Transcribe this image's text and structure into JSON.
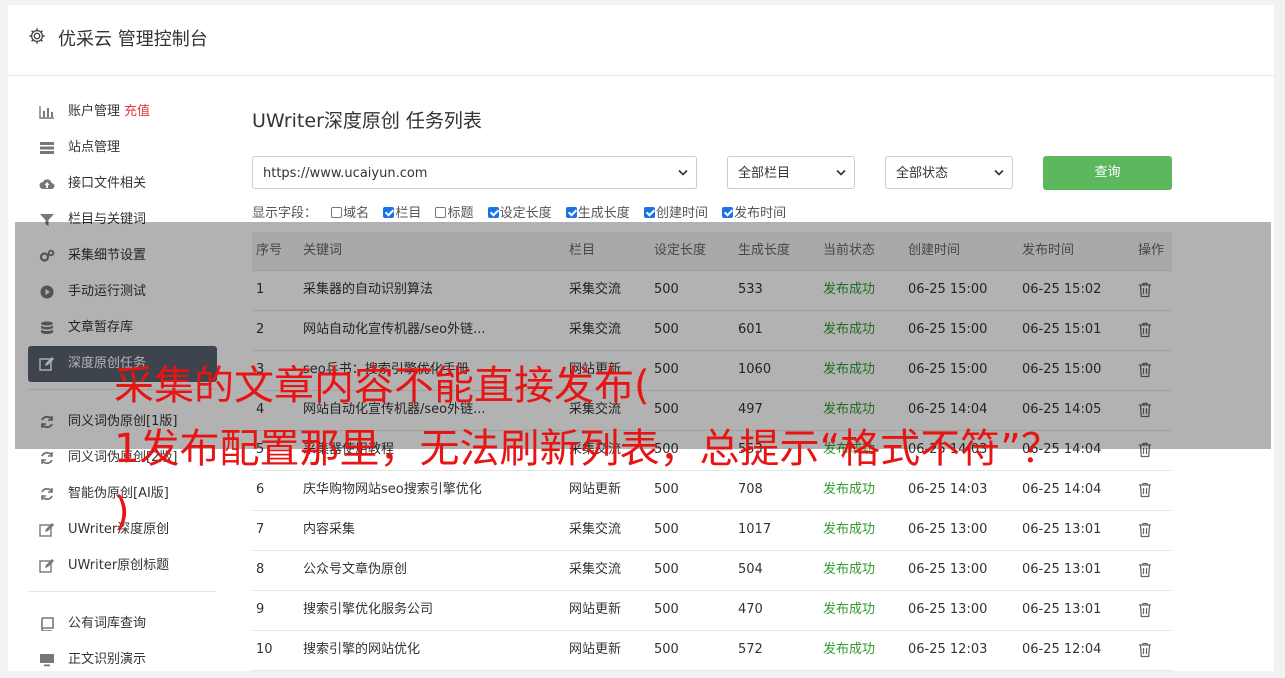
{
  "app_title": "优采云 管理控制台",
  "sidebar": {
    "items": [
      {
        "label": "账户管理",
        "badge": "充值",
        "icon": "bar-chart-icon"
      },
      {
        "label": "站点管理",
        "icon": "server-icon"
      },
      {
        "label": "接口文件相关",
        "icon": "cloud-upload-icon"
      },
      {
        "label": "栏目与关键词",
        "icon": "filter-icon"
      },
      {
        "label": "采集细节设置",
        "icon": "cogs-icon"
      },
      {
        "label": "手动运行测试",
        "icon": "play-circle-icon"
      },
      {
        "label": "文章暂存库",
        "icon": "database-icon"
      },
      {
        "label": "深度原创任务",
        "icon": "edit-icon",
        "active": true
      },
      {
        "label": "同义词伪原创[1版]",
        "icon": "refresh-icon"
      },
      {
        "label": "同义词伪原创[2版]",
        "icon": "refresh-icon"
      },
      {
        "label": "智能伪原创[AI版]",
        "icon": "refresh-icon"
      },
      {
        "label": "UWriter深度原创",
        "icon": "edit-icon"
      },
      {
        "label": "UWriter原创标题",
        "icon": "edit-icon"
      },
      {
        "label": "公有词库查询",
        "icon": "book-icon"
      },
      {
        "label": "正文识别演示",
        "icon": "monitor-icon"
      }
    ]
  },
  "page_title": "UWriter深度原创 任务列表",
  "filters": {
    "site": "https://www.ucaiyun.com",
    "column": "全部栏目",
    "status": "全部状态",
    "query_button": "查询"
  },
  "fields": {
    "label": "显示字段：",
    "items": [
      {
        "label": "域名",
        "checked": false
      },
      {
        "label": "栏目",
        "checked": true
      },
      {
        "label": "标题",
        "checked": false
      },
      {
        "label": "设定长度",
        "checked": true
      },
      {
        "label": "生成长度",
        "checked": true
      },
      {
        "label": "创建时间",
        "checked": true
      },
      {
        "label": "发布时间",
        "checked": true
      }
    ]
  },
  "table": {
    "headers": [
      "序号",
      "关键词",
      "栏目",
      "设定长度",
      "生成长度",
      "当前状态",
      "创建时间",
      "发布时间",
      "操作"
    ],
    "rows": [
      {
        "no": "1",
        "keyword": "采集器的自动识别算法",
        "column": "采集交流",
        "set_len": "500",
        "gen_len": "533",
        "status": "发布成功",
        "created": "06-25 15:00",
        "published": "06-25 15:02"
      },
      {
        "no": "2",
        "keyword": "网站自动化宣传机器/seo外链...",
        "column": "采集交流",
        "set_len": "500",
        "gen_len": "601",
        "status": "发布成功",
        "created": "06-25 15:00",
        "published": "06-25 15:01"
      },
      {
        "no": "3",
        "keyword": "seo兵书：搜索引擎优化手册",
        "column": "网站更新",
        "set_len": "500",
        "gen_len": "1060",
        "status": "发布成功",
        "created": "06-25 15:00",
        "published": "06-25 15:00"
      },
      {
        "no": "4",
        "keyword": "网站自动化宣传机器/seo外链...",
        "column": "采集交流",
        "set_len": "500",
        "gen_len": "497",
        "status": "发布成功",
        "created": "06-25 14:04",
        "published": "06-25 14:05"
      },
      {
        "no": "5",
        "keyword": "采集器使用教程",
        "column": "采集交流",
        "set_len": "500",
        "gen_len": "553",
        "status": "发布成功",
        "created": "06-25 14:03",
        "published": "06-25 14:04"
      },
      {
        "no": "6",
        "keyword": "庆华购物网站seo搜索引擎优化",
        "column": "网站更新",
        "set_len": "500",
        "gen_len": "708",
        "status": "发布成功",
        "created": "06-25 14:03",
        "published": "06-25 14:04"
      },
      {
        "no": "7",
        "keyword": "内容采集",
        "column": "采集交流",
        "set_len": "500",
        "gen_len": "1017",
        "status": "发布成功",
        "created": "06-25 13:00",
        "published": "06-25 13:01"
      },
      {
        "no": "8",
        "keyword": "公众号文章伪原创",
        "column": "采集交流",
        "set_len": "500",
        "gen_len": "504",
        "status": "发布成功",
        "created": "06-25 13:00",
        "published": "06-25 13:01"
      },
      {
        "no": "9",
        "keyword": "搜索引擎优化服务公司",
        "column": "网站更新",
        "set_len": "500",
        "gen_len": "470",
        "status": "发布成功",
        "created": "06-25 13:00",
        "published": "06-25 13:01"
      },
      {
        "no": "10",
        "keyword": "搜索引擎的网站优化",
        "column": "网站更新",
        "set_len": "500",
        "gen_len": "572",
        "status": "发布成功",
        "created": "06-25 12:03",
        "published": "06-25 12:04"
      }
    ]
  },
  "caption": {
    "line1": "采集的文章内容不能直接发布(",
    "line2": "1发布配置那里，无法刷新列表，总提示“格式不符”？",
    "line3": ")"
  },
  "colors": {
    "accent_green": "#5cb85c",
    "status_green": "#2e9b2e",
    "caption_red": "#e81414",
    "active_nav": "#5a6270"
  }
}
